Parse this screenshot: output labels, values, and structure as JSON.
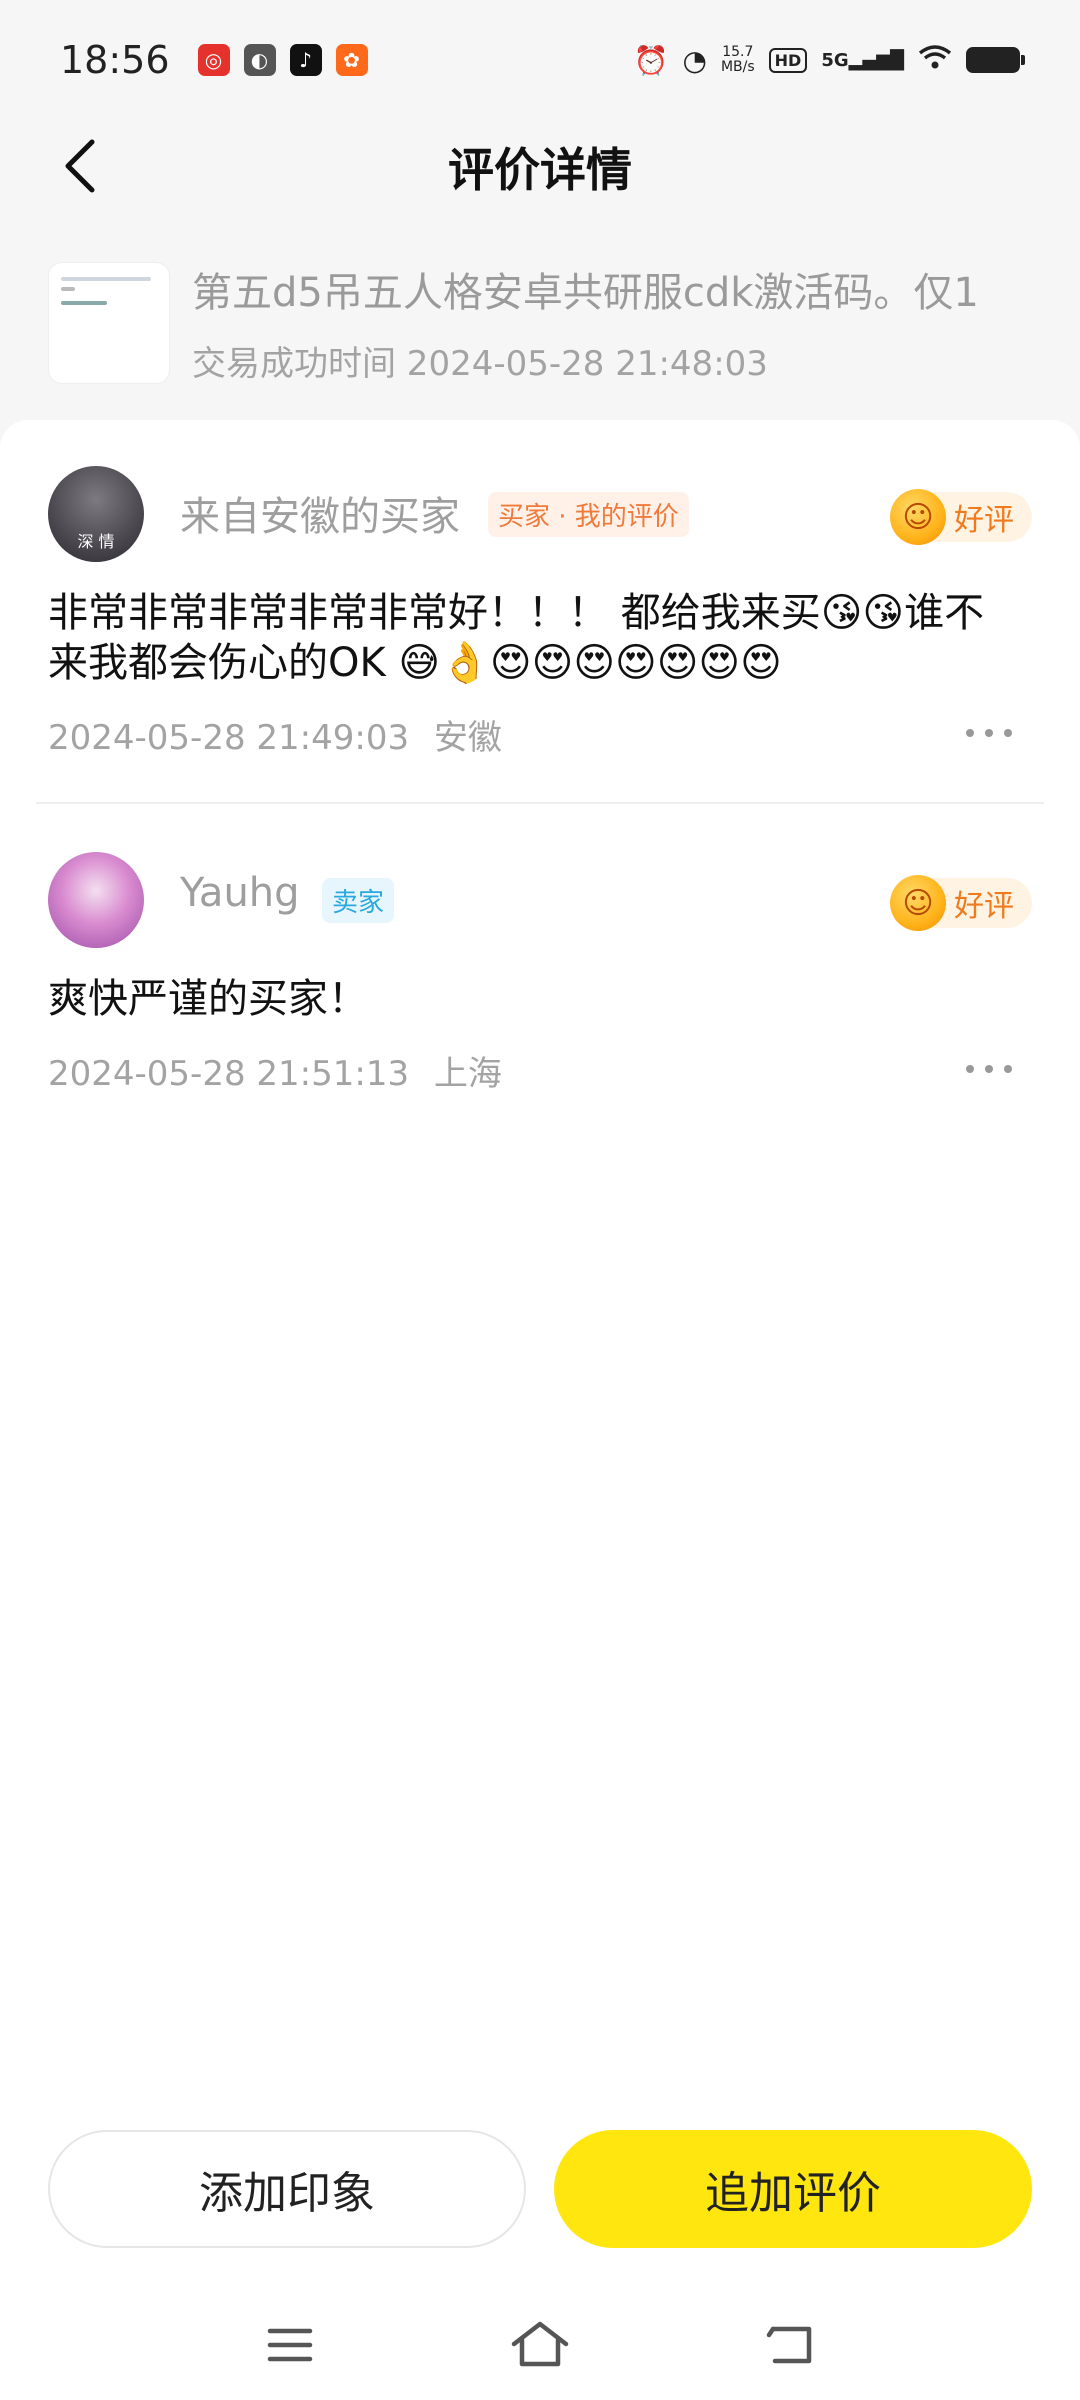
{
  "status_bar": {
    "time": "18:56",
    "speed_value": "15.7",
    "speed_unit": "MB/s",
    "hd": "HD",
    "network": "5G",
    "app_icons": [
      "netease-music-icon",
      "browser-icon",
      "tiktok-icon",
      "taobao-icon"
    ]
  },
  "nav": {
    "title": "评价详情"
  },
  "product": {
    "title": "第五d5吊五人格安卓共研服cdk激活码。仅1",
    "trade_time": "交易成功时间 2024-05-28 21:48:03"
  },
  "reviews": [
    {
      "avatar_text": "深 情",
      "name": "来自安徽的买家",
      "tag": "买家 · 我的评价",
      "rating": "好评",
      "content": "非常非常非常非常非常好！！！ 都给我来买😘😘谁不来我都会伤心的OK 😅👌😍😍😍😍😍😍😍",
      "time": "2024-05-28 21:49:03",
      "location": "安徽"
    },
    {
      "name": "Yauhg",
      "tag": "卖家",
      "rating": "好评",
      "content": "爽快严谨的买家！",
      "time": "2024-05-28 21:51:13",
      "location": "上海"
    }
  ],
  "actions": {
    "add_impression": "添加印象",
    "add_review": "追加评价"
  },
  "colors": {
    "primary_yellow": "#ffe60f",
    "buyer_tag": "#f07a3a",
    "seller_tag": "#29a9de",
    "good_rating": "#f07a1c"
  }
}
